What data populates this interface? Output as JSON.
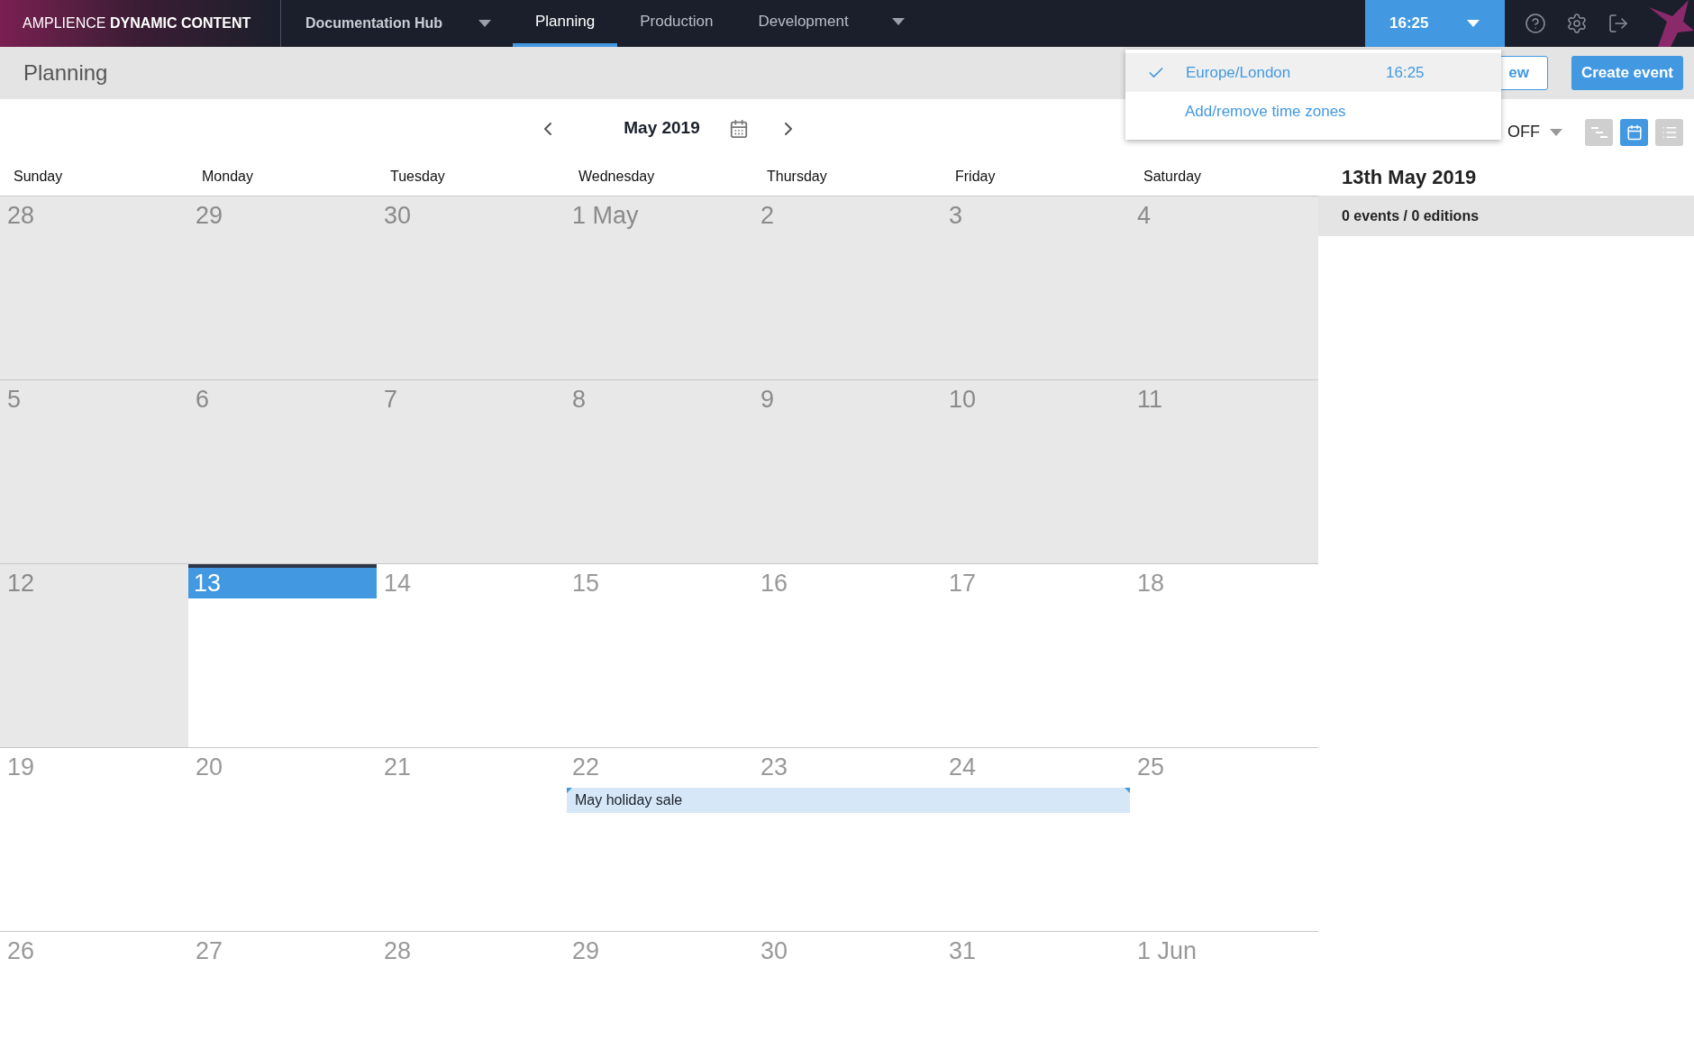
{
  "logo": "AMPLIENCE **DYNAMIC CONTENT**",
  "hub": {
    "label": "Documentation Hub"
  },
  "nav_tabs": [
    {
      "label": "Planning",
      "selected": true
    },
    {
      "label": "Production",
      "selected": false
    },
    {
      "label": "Development",
      "selected": false,
      "dropdown": true
    }
  ],
  "clock": {
    "time": "16:25",
    "expanded": true
  },
  "timezone_menu": {
    "zones": [
      {
        "name": "Europe/London",
        "time": "16:25",
        "selected": true
      }
    ],
    "action": "Add/remove time zones"
  },
  "page_title": "Planning",
  "actions": [
    {
      "label": "ew",
      "kind": "outline"
    },
    {
      "label": "Create event",
      "kind": "primary"
    }
  ],
  "month_nav": {
    "label": "May 2019"
  },
  "toggle": {
    "value": "OFF"
  },
  "views": [
    {
      "kind": "timeline",
      "selected": false
    },
    {
      "kind": "calendar",
      "selected": true
    },
    {
      "kind": "list",
      "selected": false
    }
  ],
  "weekdays": [
    "Sunday",
    "Monday",
    "Tuesday",
    "Wednesday",
    "Thursday",
    "Friday",
    "Saturday"
  ],
  "weeks": [
    {
      "days": [
        {
          "label": "28",
          "past": true
        },
        {
          "label": "29",
          "past": true
        },
        {
          "label": "30",
          "past": true
        },
        {
          "label": "1 May",
          "past": true
        },
        {
          "label": "2",
          "past": true
        },
        {
          "label": "3",
          "past": true
        },
        {
          "label": "4",
          "past": true
        }
      ]
    },
    {
      "days": [
        {
          "label": "5",
          "past": true
        },
        {
          "label": "6",
          "past": true
        },
        {
          "label": "7",
          "past": true
        },
        {
          "label": "8",
          "past": true
        },
        {
          "label": "9",
          "past": true
        },
        {
          "label": "10",
          "past": true
        },
        {
          "label": "11",
          "past": true
        }
      ]
    },
    {
      "days": [
        {
          "label": "12",
          "past": true
        },
        {
          "label": "13",
          "past": false,
          "selected": true
        },
        {
          "label": "14",
          "past": false
        },
        {
          "label": "15",
          "past": false
        },
        {
          "label": "16",
          "past": false
        },
        {
          "label": "17",
          "past": false
        },
        {
          "label": "18",
          "past": false
        }
      ]
    },
    {
      "days": [
        {
          "label": "19",
          "past": false
        },
        {
          "label": "20",
          "past": false
        },
        {
          "label": "21",
          "past": false
        },
        {
          "label": "22",
          "past": false,
          "event": true
        },
        {
          "label": "23",
          "past": false,
          "event": true
        },
        {
          "label": "24",
          "past": false,
          "event": true
        },
        {
          "label": "25",
          "past": false
        }
      ],
      "event_title": "May holiday sale"
    },
    {
      "days": [
        {
          "label": "26",
          "past": false
        },
        {
          "label": "27",
          "past": false
        },
        {
          "label": "28",
          "past": false
        },
        {
          "label": "29",
          "past": false
        },
        {
          "label": "30",
          "past": false
        },
        {
          "label": "31",
          "past": false
        },
        {
          "label": "1 Jun",
          "past": false
        }
      ]
    }
  ],
  "side_panel": {
    "title": "13th May 2019",
    "summary": "0 events / 0 editions"
  }
}
